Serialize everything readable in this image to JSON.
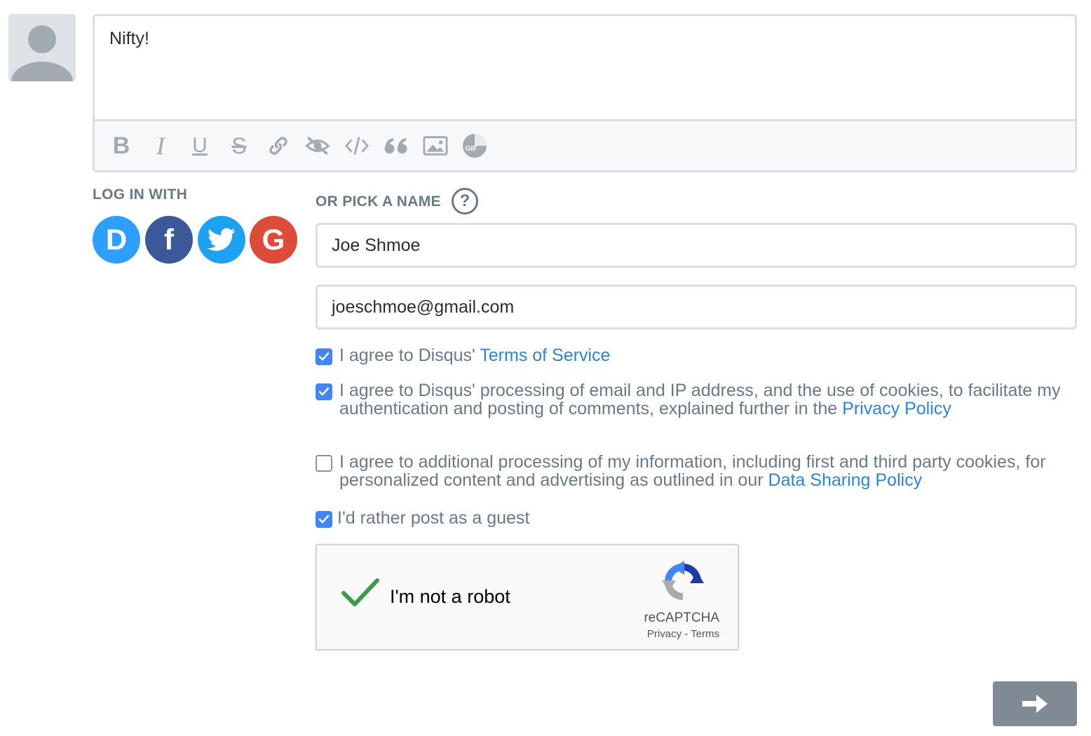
{
  "comment": {
    "text": "Nifty!"
  },
  "toolbar": {
    "bold_label": "B",
    "italic_label": "I",
    "underline_label": "U",
    "strike_label": "S",
    "gif_label": "GIF"
  },
  "login": {
    "label": "LOG IN WITH",
    "providers": [
      {
        "name": "Disqus",
        "letter": "D",
        "color": "#2e9fff"
      },
      {
        "name": "Facebook",
        "letter": "f",
        "color": "#3b5998"
      },
      {
        "name": "Twitter",
        "letter": "",
        "color": "#1da1f2"
      },
      {
        "name": "Google",
        "letter": "G",
        "color": "#dd4b39"
      }
    ]
  },
  "guest_form": {
    "label": "OR PICK A NAME",
    "help_label": "?",
    "name_value": "Joe Shmoe",
    "email_value": "joeschmoe@gmail.com"
  },
  "consents": {
    "tos": {
      "checked": true,
      "text": "I agree to Disqus' ",
      "link": "Terms of Service"
    },
    "processing": {
      "checked": true,
      "text": "I agree to Disqus' processing of email and IP address, and the use of cookies, to facilitate my authentication and posting of comments, explained further in the ",
      "link": "Privacy Policy"
    },
    "additional": {
      "checked": false,
      "text": "I agree to additional processing of my information, including first and third party cookies, for personalized content and advertising as outlined in our ",
      "link": "Data Sharing Policy"
    },
    "guest": {
      "checked": true,
      "text": "I'd rather post as a guest"
    }
  },
  "recaptcha": {
    "checked": true,
    "label": "I'm not a robot",
    "brand": "reCAPTCHA",
    "links": "Privacy - Terms"
  },
  "colors": {
    "accent": "#4285f4",
    "link": "#2e84d4",
    "muted": "#687a86",
    "submit": "#7f8a94"
  }
}
